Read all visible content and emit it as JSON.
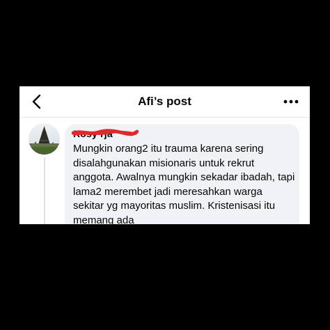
{
  "header": {
    "title": "Afi’s post"
  },
  "comment": {
    "author_visible": "Rosy           rja",
    "text": "Mungkin orang2 itu trauma karena sering disalahgunakan misionaris untuk rekrut anggota. Awalnya mungkin sekadar ibadah, tapi lama2 merembet jadi meresahkan warga sekitar yg mayoritas muslim. Kristenisasi itu memang ada"
  },
  "icons": {
    "back": "chevron-left-icon",
    "more": "more-horizontal-icon",
    "avatar": "temple-photo"
  },
  "colors": {
    "background": "#000000",
    "screen": "#ffffff",
    "bubble": "#f0f2f5",
    "text": "#050505",
    "redaction": "#e0282e"
  }
}
